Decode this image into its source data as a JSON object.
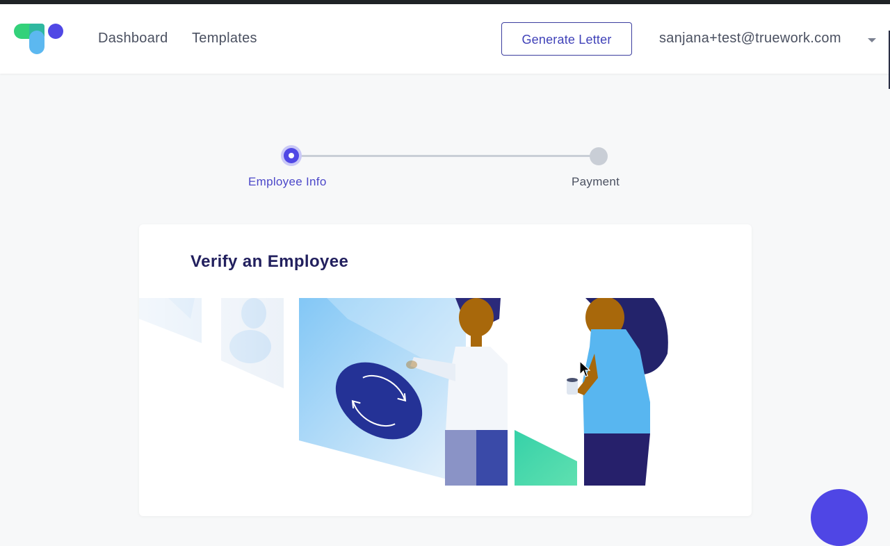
{
  "nav": {
    "links": [
      "Dashboard",
      "Templates"
    ],
    "generate_button": "Generate Letter",
    "user_email": "sanjana+test@truework.com"
  },
  "stepper": {
    "steps": [
      {
        "label": "Employee Info",
        "state": "active"
      },
      {
        "label": "Payment",
        "state": "inactive"
      }
    ]
  },
  "card": {
    "title": "Verify an Employee"
  },
  "colors": {
    "accent": "#5048e5",
    "title": "#22205e",
    "text": "#4a5060",
    "background": "#f7f8f9"
  },
  "icons": [
    "truework-logo-icon",
    "chevron-down-icon",
    "refresh-icon",
    "cursor-icon",
    "chat-icon"
  ]
}
